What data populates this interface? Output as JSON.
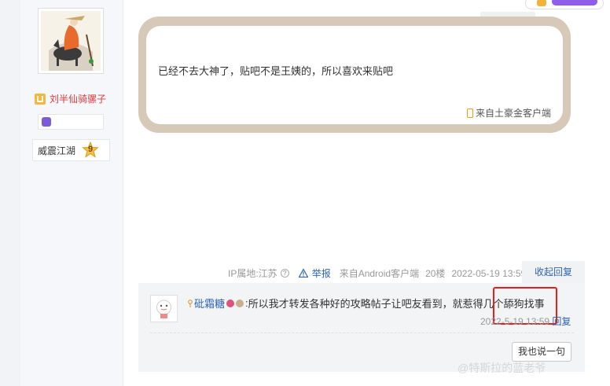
{
  "author": {
    "username": "刘半仙骑骡子",
    "rank": "威震江湖",
    "level": "9"
  },
  "post": {
    "content": "已经不去大神了，贴吧不是王姨的，所以喜欢来贴吧",
    "client_tag": "来自土豪金客户端"
  },
  "meta": {
    "ip_location": "IP属地:江苏",
    "help_glyph": "?",
    "report": "举报",
    "client": "来自Android客户端",
    "floor": "20楼",
    "time": "2022-05-19 13:59",
    "collapse": "收起回复"
  },
  "reply": {
    "username": "砒霜糖",
    "colon": ":",
    "text": "所以我才转发各种好的攻略帖子让吧友看到，就惹得几个舔狗找事",
    "time": "2022-5-19 13:59",
    "reply_link": "回复",
    "say_button": "我也说一句"
  },
  "watermark": "@特斯拉的蓝老爷",
  "colors": {
    "link": "#2d64b3",
    "username_red": "#e03b3b",
    "bubble_frame": "#d7c9b7",
    "highlight_red": "#e02020"
  },
  "icons": [
    "crown-icon",
    "gem-icon",
    "level-star-icon",
    "phone-icon",
    "help-icon",
    "warning-icon",
    "pin-icon",
    "badge-icon"
  ]
}
